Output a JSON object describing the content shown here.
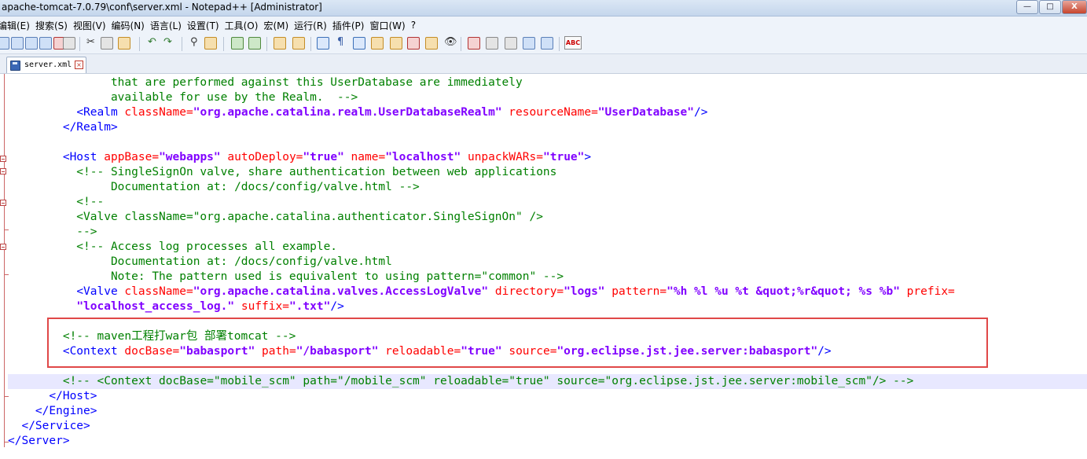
{
  "window": {
    "title": "apache-tomcat-7.0.79\\conf\\server.xml - Notepad++ [Administrator]",
    "minimize_label": "—",
    "maximize_label": "□",
    "close_label": "X"
  },
  "menu": [
    {
      "label": "编辑(E)"
    },
    {
      "label": "搜索(S)"
    },
    {
      "label": "视图(V)"
    },
    {
      "label": "编码(N)"
    },
    {
      "label": "语言(L)"
    },
    {
      "label": "设置(T)"
    },
    {
      "label": "工具(O)"
    },
    {
      "label": "宏(M)"
    },
    {
      "label": "运行(R)"
    },
    {
      "label": "插件(P)"
    },
    {
      "label": "窗口(W)"
    },
    {
      "label": "?"
    }
  ],
  "toolbar": {
    "spellcheck_label": "ABC"
  },
  "tabs": [
    {
      "label": "server.xml",
      "active": true
    }
  ],
  "colors": {
    "comment": "#008000",
    "tag": "#0000ff",
    "attribute": "#ff0000",
    "value": "#8000ff",
    "current_line": "#e8e8ff",
    "highlight_box": "#e04848"
  },
  "editor": {
    "lines": [
      [
        {
          "t": "comment",
          "s": "               that are performed against this UserDatabase are immediately"
        }
      ],
      [
        {
          "t": "comment",
          "s": "               available for use by the Realm.  -->"
        }
      ],
      [
        {
          "t": "text",
          "s": "          "
        },
        {
          "t": "tag",
          "s": "<Realm "
        },
        {
          "t": "attr",
          "s": "className="
        },
        {
          "t": "val",
          "s": "\"org.apache.catalina.realm.UserDatabaseRealm\""
        },
        {
          "t": "attr",
          "s": " resourceName="
        },
        {
          "t": "val",
          "s": "\"UserDatabase\""
        },
        {
          "t": "tag",
          "s": "/>"
        }
      ],
      [
        {
          "t": "text",
          "s": "        "
        },
        {
          "t": "tag",
          "s": "</Realm>"
        }
      ],
      [
        {
          "t": "text",
          "s": ""
        }
      ],
      [
        {
          "t": "text",
          "s": "        "
        },
        {
          "t": "tag",
          "s": "<Host "
        },
        {
          "t": "attr",
          "s": "appBase="
        },
        {
          "t": "val",
          "s": "\"webapps\""
        },
        {
          "t": "attr",
          "s": " autoDeploy="
        },
        {
          "t": "val",
          "s": "\"true\""
        },
        {
          "t": "attr",
          "s": " name="
        },
        {
          "t": "val",
          "s": "\"localhost\""
        },
        {
          "t": "attr",
          "s": " unpackWARs="
        },
        {
          "t": "val",
          "s": "\"true\""
        },
        {
          "t": "tag",
          "s": ">"
        }
      ],
      [
        {
          "t": "comment",
          "s": "          <!-- SingleSignOn valve, share authentication between web applications"
        }
      ],
      [
        {
          "t": "comment",
          "s": "               Documentation at: /docs/config/valve.html -->"
        }
      ],
      [
        {
          "t": "comment",
          "s": "          <!--"
        }
      ],
      [
        {
          "t": "comment",
          "s": "          <Valve className=\"org.apache.catalina.authenticator.SingleSignOn\" />"
        }
      ],
      [
        {
          "t": "comment",
          "s": "          -->"
        }
      ],
      [
        {
          "t": "comment",
          "s": "          <!-- Access log processes all example."
        }
      ],
      [
        {
          "t": "comment",
          "s": "               Documentation at: /docs/config/valve.html"
        }
      ],
      [
        {
          "t": "comment",
          "s": "               Note: The pattern used is equivalent to using pattern=\"common\" -->"
        }
      ],
      [
        {
          "t": "text",
          "s": "          "
        },
        {
          "t": "tag",
          "s": "<Valve "
        },
        {
          "t": "attr",
          "s": "className="
        },
        {
          "t": "val",
          "s": "\"org.apache.catalina.valves.AccessLogValve\""
        },
        {
          "t": "attr",
          "s": " directory="
        },
        {
          "t": "val",
          "s": "\"logs\""
        },
        {
          "t": "attr",
          "s": " pattern="
        },
        {
          "t": "val",
          "s": "\"%h %l %u %t &quot;%r&quot; %s %b\""
        },
        {
          "t": "attr",
          "s": " prefix="
        }
      ],
      [
        {
          "t": "text",
          "s": "          "
        },
        {
          "t": "val",
          "s": "\"localhost_access_log.\""
        },
        {
          "t": "attr",
          "s": " suffix="
        },
        {
          "t": "val",
          "s": "\".txt\""
        },
        {
          "t": "tag",
          "s": "/>"
        }
      ],
      [
        {
          "t": "text",
          "s": ""
        }
      ],
      [
        {
          "t": "text",
          "s": "        "
        },
        {
          "t": "comment",
          "s": "<!-- maven工程打war包 部署tomcat -->"
        }
      ],
      [
        {
          "t": "text",
          "s": "        "
        },
        {
          "t": "tag",
          "s": "<Context "
        },
        {
          "t": "attr",
          "s": "docBase="
        },
        {
          "t": "val",
          "s": "\"babasport\""
        },
        {
          "t": "attr",
          "s": " path="
        },
        {
          "t": "val",
          "s": "\"/babasport\""
        },
        {
          "t": "attr",
          "s": " reloadable="
        },
        {
          "t": "val",
          "s": "\"true\""
        },
        {
          "t": "attr",
          "s": " source="
        },
        {
          "t": "val",
          "s": "\"org.eclipse.jst.jee.server:babasport\""
        },
        {
          "t": "tag",
          "s": "/>"
        }
      ],
      [
        {
          "t": "text",
          "s": ""
        }
      ],
      [
        {
          "t": "text",
          "s": "        "
        },
        {
          "t": "comment",
          "s": "<!-- <Context docBase=\"mobile_scm\" path=\"/mobile_scm\" reloadable=\"true\" source=\"org.eclipse.jst.jee.server:mobile_scm\"/> -->"
        }
      ],
      [
        {
          "t": "text",
          "s": "      "
        },
        {
          "t": "tag",
          "s": "</Host>"
        }
      ],
      [
        {
          "t": "text",
          "s": "    "
        },
        {
          "t": "tag",
          "s": "</Engine>"
        }
      ],
      [
        {
          "t": "text",
          "s": "  "
        },
        {
          "t": "tag",
          "s": "</Service>"
        }
      ],
      [
        {
          "t": "tag",
          "s": "</Server>"
        }
      ]
    ],
    "current_line_index": 20
  }
}
